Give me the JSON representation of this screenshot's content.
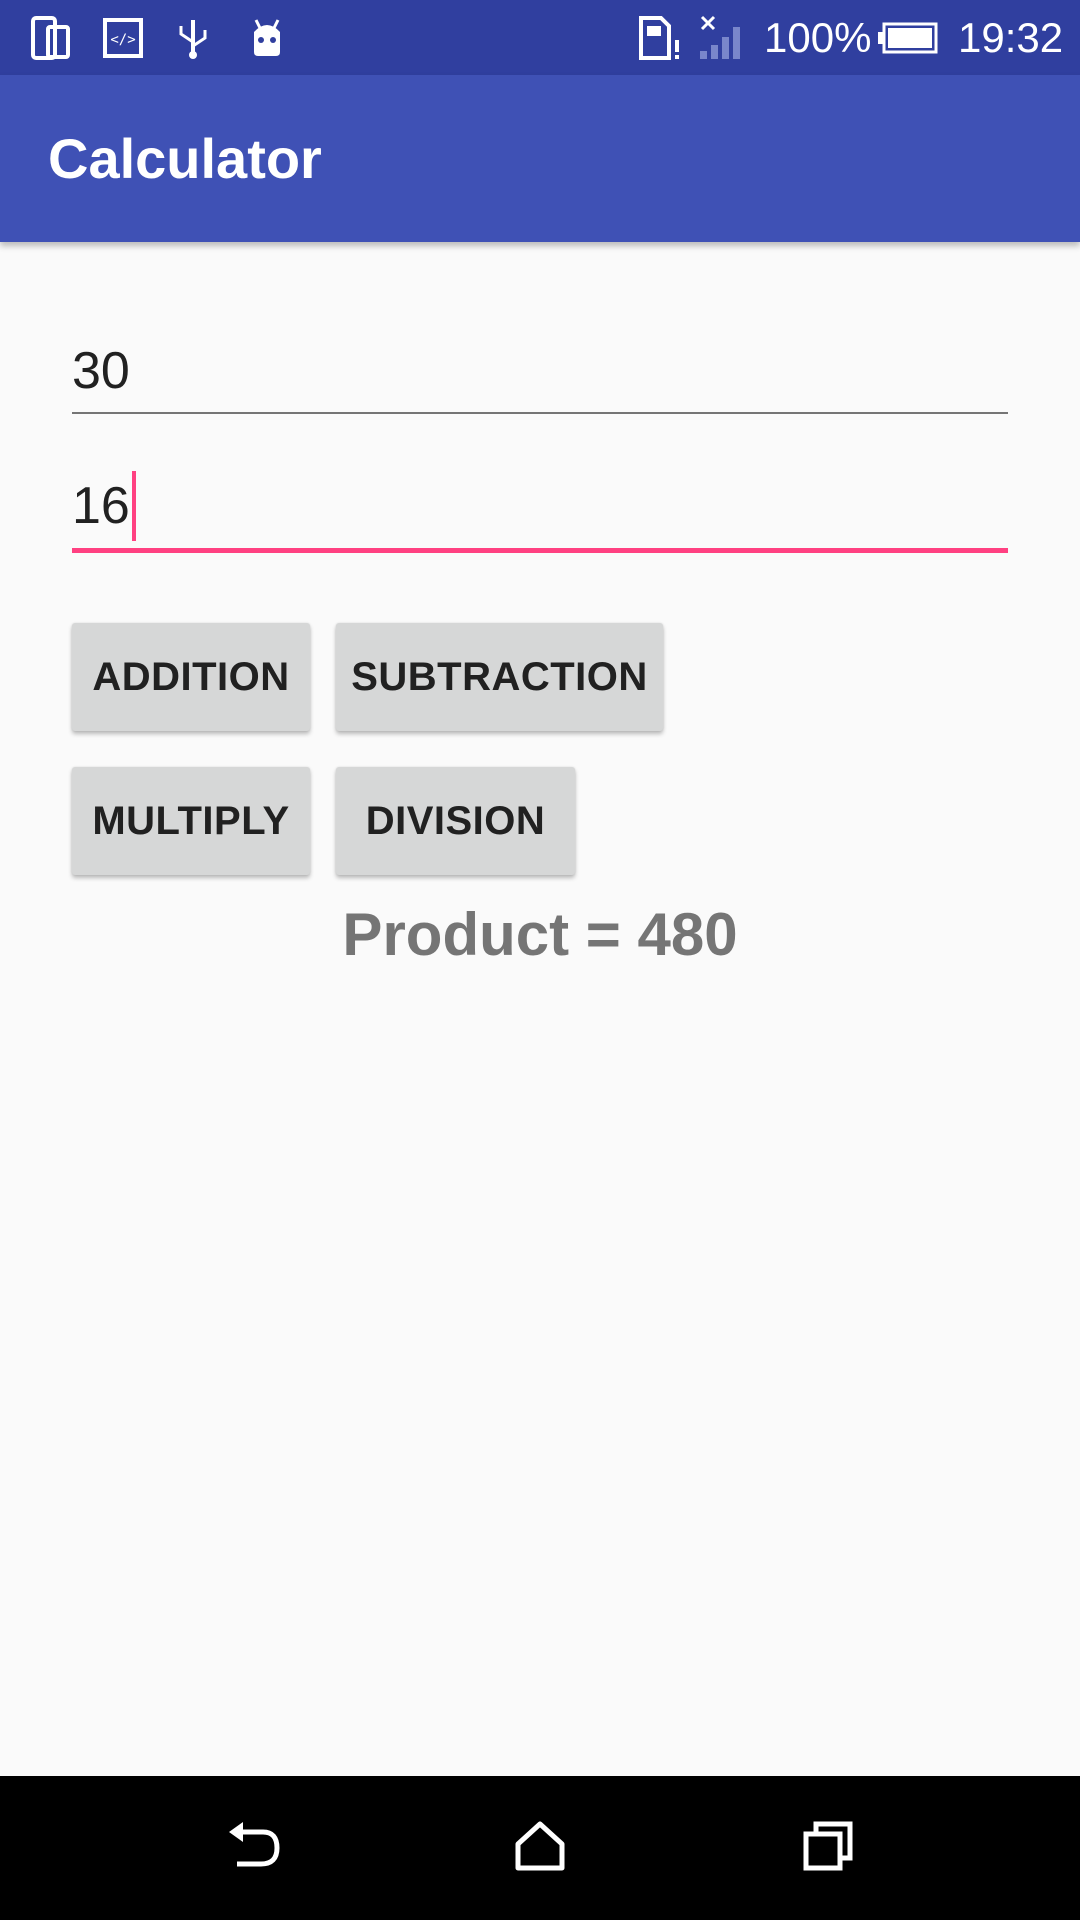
{
  "status_bar": {
    "icons": [
      "phone-tablet-icon",
      "code-icon",
      "usb-icon",
      "android-icon",
      "sim-alert-icon",
      "signal-icon",
      "battery-icon"
    ],
    "battery_percent": "100%",
    "time": "19:32"
  },
  "app_bar": {
    "title": "Calculator"
  },
  "inputs": {
    "first_number": "30",
    "second_number": "16"
  },
  "buttons": {
    "addition": "ADDITION",
    "subtraction": "SUBTRACTION",
    "multiply": "MULTIPLY",
    "division": "DIVISION"
  },
  "result": {
    "text": "Product = 480"
  },
  "nav_bar": {
    "icons": [
      "back-icon",
      "home-icon",
      "recents-icon"
    ]
  },
  "colors": {
    "status_bar": "#303f9f",
    "app_bar": "#3f51b5",
    "accent": "#ff4081",
    "button": "#d6d7d7",
    "result_text": "#757575"
  }
}
